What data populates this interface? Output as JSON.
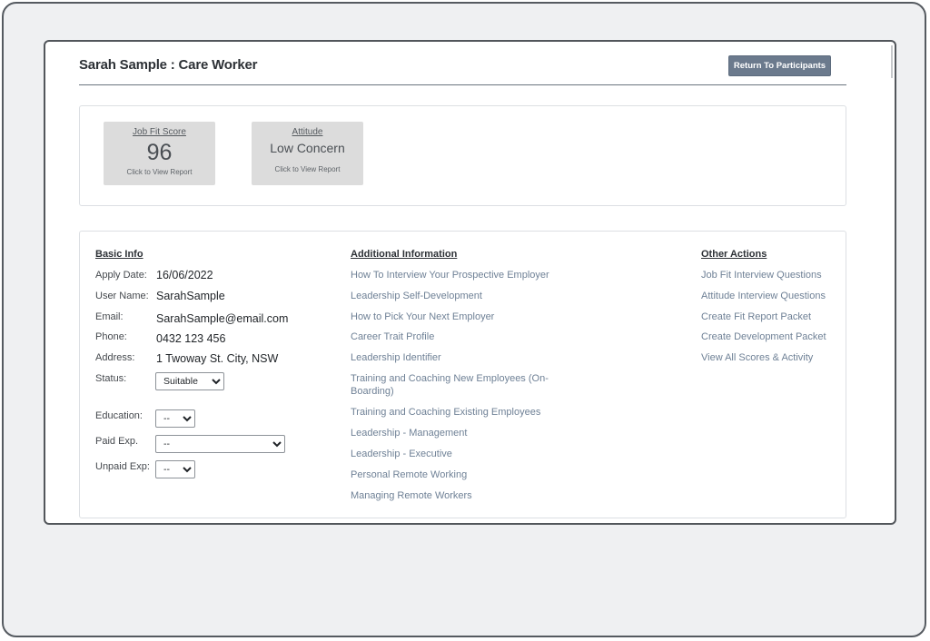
{
  "header": {
    "title": "Sarah Sample : Care Worker",
    "return_label": "Return To Participants"
  },
  "scores": [
    {
      "label": "Job Fit Score",
      "value": "96",
      "hint": "Click to View Report"
    },
    {
      "label": "Attitude",
      "value": "Low Concern",
      "hint": "Click to View Report"
    }
  ],
  "basic_info": {
    "heading": "Basic Info",
    "apply_date_label": "Apply Date:",
    "apply_date": "16/06/2022",
    "user_name_label": "User Name:",
    "user_name": "SarahSample",
    "email_label": "Email:",
    "email": "SarahSample@email.com",
    "phone_label": "Phone:",
    "phone": "0432 123 456",
    "address_label": "Address:",
    "address": "1 Twoway St. City, NSW",
    "status_label": "Status:",
    "status_value": "Suitable",
    "education_label": "Education:",
    "education_value": "--",
    "paid_exp_label": "Paid Exp.",
    "paid_exp_value": "--",
    "unpaid_exp_label": "Unpaid Exp:",
    "unpaid_exp_value": "--"
  },
  "additional_info": {
    "heading": "Additional Information",
    "links": [
      "How To Interview Your Prospective Employer",
      "Leadership Self-Development",
      "How to Pick Your Next Employer",
      "Career Trait Profile",
      "Leadership Identifier",
      "Training and Coaching New Employees (On-Boarding)",
      "Training and Coaching Existing Employees",
      "Leadership - Management",
      "Leadership - Executive",
      "Personal Remote Working",
      "Managing Remote Workers"
    ]
  },
  "other_actions": {
    "heading": "Other Actions",
    "links": [
      "Job Fit Interview Questions",
      "Attitude Interview Questions",
      "Create Fit Report Packet",
      "Create Development Packet",
      "View All Scores & Activity"
    ]
  }
}
